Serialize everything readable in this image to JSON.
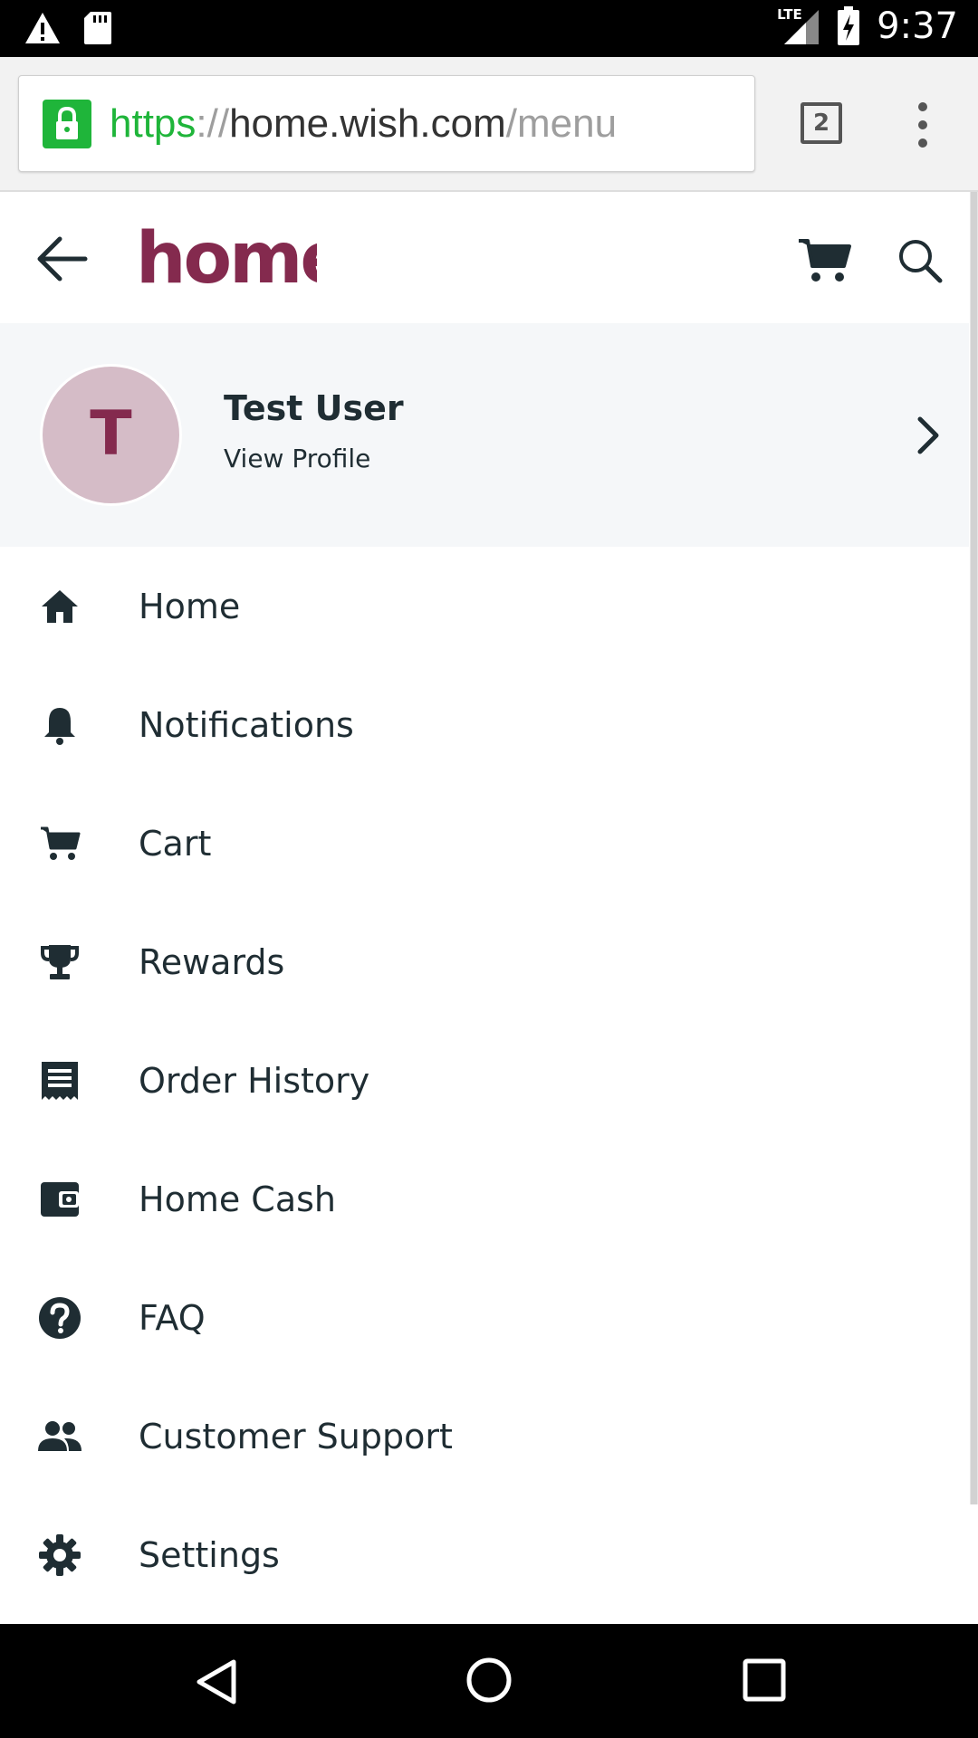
{
  "status_bar": {
    "network": "LTE",
    "time": "9:37"
  },
  "browser": {
    "url_scheme": "https",
    "url_separator": "://",
    "url_host": "home.wish.com",
    "url_path": "/menu",
    "tab_count": "2"
  },
  "app": {
    "logo_text": "home",
    "brand_color": "#842a4e"
  },
  "profile": {
    "avatar_initial": "T",
    "name": "Test User",
    "link": "View Profile"
  },
  "menu": {
    "items": [
      {
        "label": "Home",
        "icon": "home-icon"
      },
      {
        "label": "Notifications",
        "icon": "bell-icon"
      },
      {
        "label": "Cart",
        "icon": "cart-icon"
      },
      {
        "label": "Rewards",
        "icon": "trophy-icon"
      },
      {
        "label": "Order History",
        "icon": "receipt-icon"
      },
      {
        "label": "Home Cash",
        "icon": "wallet-icon"
      },
      {
        "label": "FAQ",
        "icon": "help-icon"
      },
      {
        "label": "Customer Support",
        "icon": "people-icon"
      },
      {
        "label": "Settings",
        "icon": "gear-icon"
      }
    ]
  }
}
